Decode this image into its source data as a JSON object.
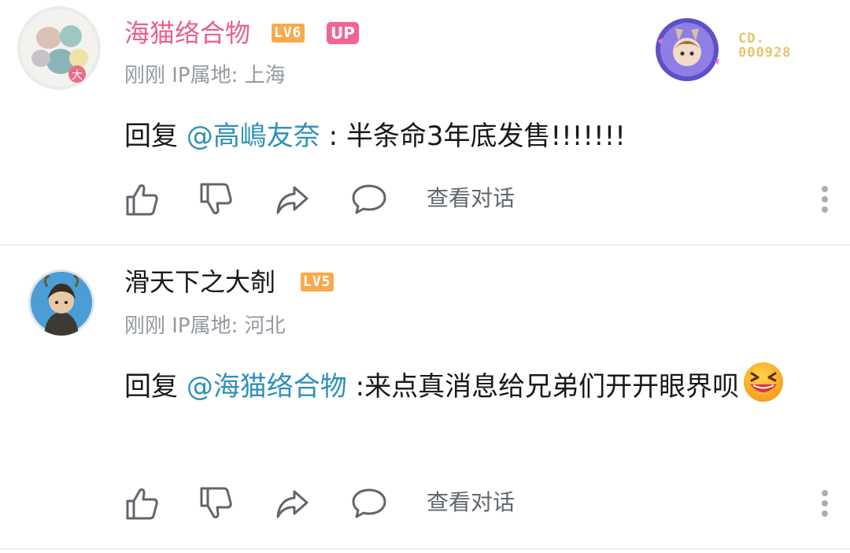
{
  "comments": [
    {
      "username": "海猫络合物",
      "level": "LV6",
      "level_color": "#f7a94b",
      "up_badge": "UP",
      "meta": "刚刚 IP属地: 上海",
      "reply_prefix": "回复",
      "mention": "@高嶋友奈",
      "reply_text": " : 半条命3年底发售!!!!!!!",
      "view_conversation": "查看对话",
      "fan_badge_code_line1": "CD.",
      "fan_badge_code_line2": "000928"
    },
    {
      "username": "滑天下之大剞",
      "level": "LV5",
      "level_color": "#f7a94b",
      "meta": "刚刚 IP属地: 河北",
      "reply_prefix": "回复",
      "mention": "@海猫络合物",
      "reply_text": " :来点真消息给兄弟们开开眼界呗",
      "view_conversation": "查看对话",
      "emoji": "laughing-emoji"
    }
  ],
  "colors": {
    "vip_name": "#e8608e",
    "mention": "#2f90b9",
    "meta": "#9499a0",
    "up_badge": "#f36392"
  }
}
